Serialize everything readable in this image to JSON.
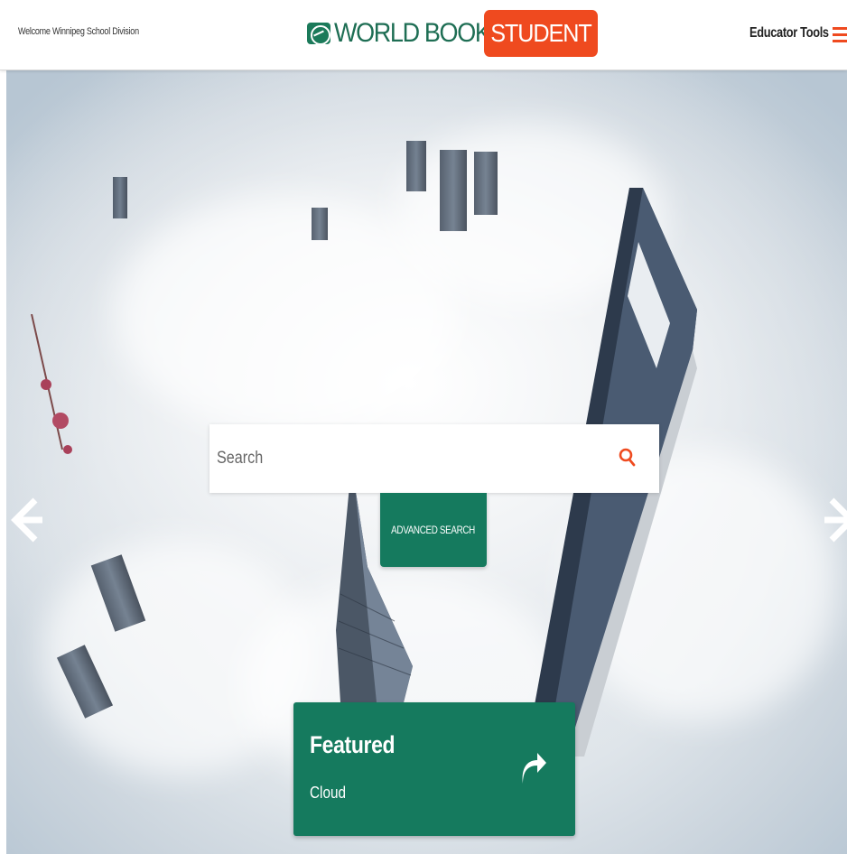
{
  "header": {
    "welcome_text": "Welcome Winnipeg School Division",
    "logo_world": "WORLD BOOK",
    "logo_student": "STUDENT",
    "educator_tools_label": "Educator Tools",
    "menu_icon": "hamburger-menu-icon"
  },
  "hero": {
    "previous_icon": "arrow-left-icon",
    "next_icon": "arrow-right-icon",
    "search": {
      "placeholder": "Search",
      "value": "",
      "icon": "search-icon"
    },
    "advanced_search_label": "ADVANCED SEARCH",
    "featured": {
      "title": "Featured",
      "subtitle": "Cloud",
      "icon": "share-arrow-icon"
    }
  },
  "colors": {
    "brand_green": "#157a5e",
    "brand_orange": "#ef4a1f",
    "logo_green": "#1e6e54"
  }
}
